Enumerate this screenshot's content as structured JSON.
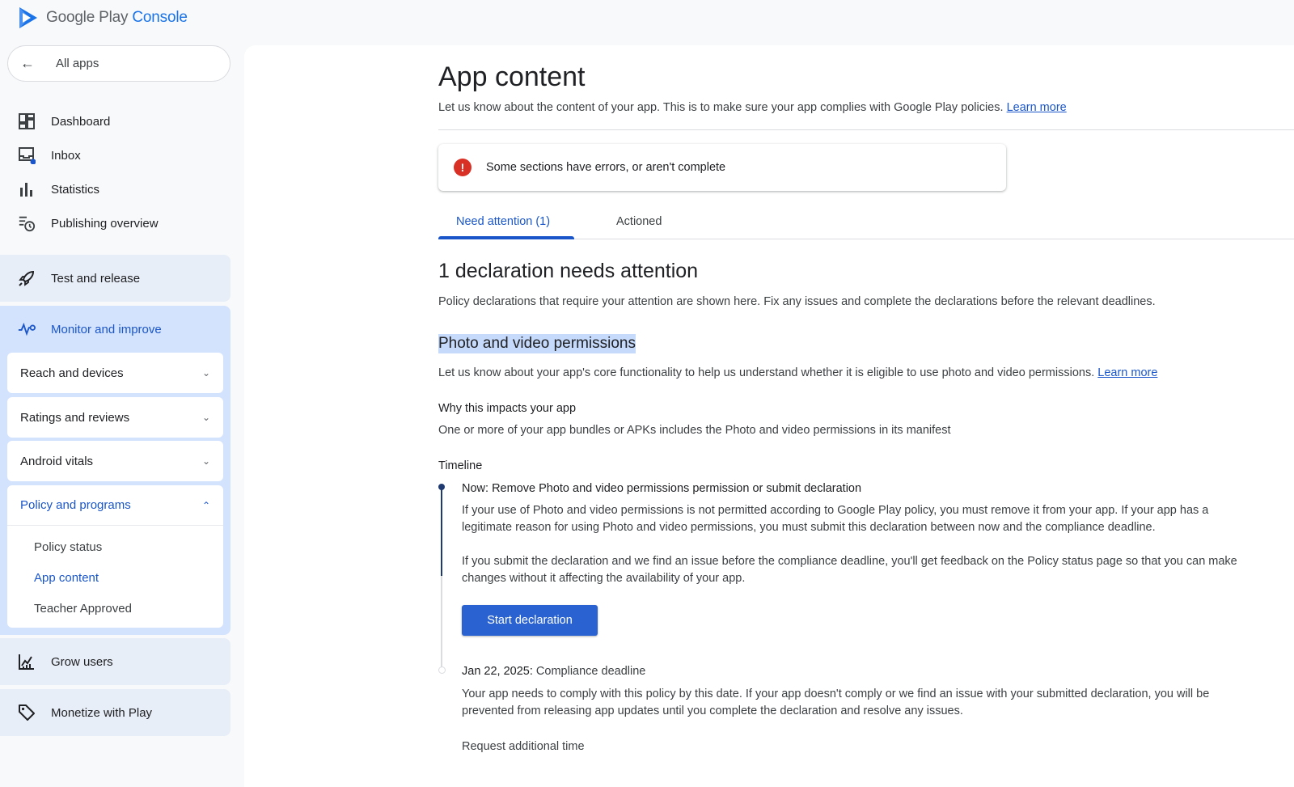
{
  "brand": {
    "name": "Google Play",
    "product": "Console"
  },
  "sidebar": {
    "all_apps": "All apps",
    "items": [
      {
        "label": "Dashboard"
      },
      {
        "label": "Inbox"
      },
      {
        "label": "Statistics"
      },
      {
        "label": "Publishing overview"
      }
    ],
    "test_release": "Test and release",
    "monitor": {
      "label": "Monitor and improve",
      "sections": [
        {
          "label": "Reach and devices"
        },
        {
          "label": "Ratings and reviews"
        },
        {
          "label": "Android vitals"
        }
      ],
      "policy": {
        "label": "Policy and programs",
        "items": [
          {
            "label": "Policy status"
          },
          {
            "label": "App content"
          },
          {
            "label": "Teacher Approved"
          }
        ]
      }
    },
    "grow": "Grow users",
    "monetize": "Monetize with Play"
  },
  "main": {
    "title": "App content",
    "description": "Let us know about the content of your app. This is to make sure your app complies with Google Play policies.",
    "learn_more": "Learn more",
    "alert": "Some sections have errors, or aren't complete",
    "tabs": [
      {
        "label": "Need attention (1)"
      },
      {
        "label": "Actioned"
      }
    ],
    "heading": "1 declaration needs attention",
    "heading_desc": "Policy declarations that require your attention are shown here. Fix any issues and complete the declarations before the relevant deadlines.",
    "section_title": "Photo and video permissions",
    "section_desc": "Let us know about your app's core functionality to help us understand whether it is eligible to use photo and video permissions.",
    "section_learn_more": "Learn more",
    "why_title": "Why this impacts your app",
    "why_desc": "One or more of your app bundles or APKs includes the Photo and video permissions in its manifest",
    "timeline_title": "Timeline",
    "timeline": {
      "now_label": "Now:",
      "now_text": "Remove Photo and video permissions permission or submit declaration",
      "now_p1": "If your use of Photo and video permissions is not permitted according to Google Play policy, you must remove it from your app. If your app has a legitimate reason for using Photo and video permissions, you must submit this declaration between now and the compliance deadline.",
      "now_p2": "If you submit the declaration and we find an issue before the compliance deadline, you'll get feedback on the Policy status page so that you can make changes without it affecting the availability of your app.",
      "button": "Start declaration",
      "date_label": "Jan 22, 2025:",
      "date_text": "Compliance deadline",
      "date_p": "Your app needs to comply with this policy by this date. If your app doesn't comply or we find an issue with your submitted declaration, you will be prevented from releasing app updates until you complete the declaration and resolve any issues.",
      "request": "Request additional time"
    }
  },
  "colors": {
    "accent": "#1a56c9",
    "error": "#d93025",
    "active_bg": "#d3e3fd",
    "button": "#2a63d1"
  }
}
